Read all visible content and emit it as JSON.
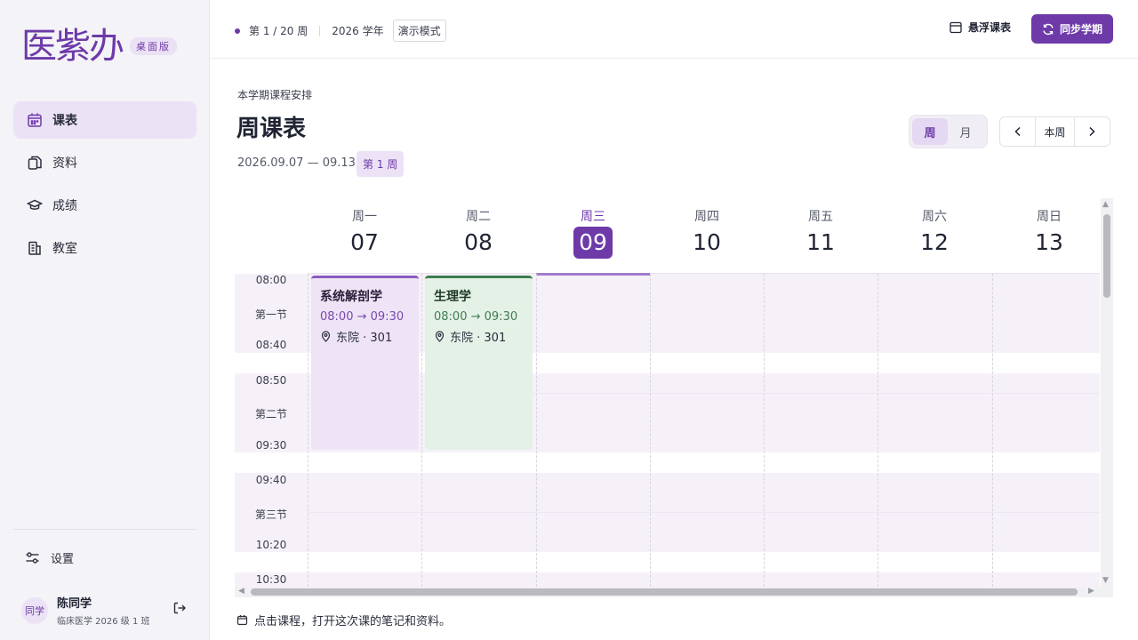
{
  "app": {
    "logo_text": "医紫办",
    "edition_badge": "桌面版"
  },
  "sidebar": {
    "items": [
      {
        "label": "课表",
        "icon": "calendar-icon",
        "active": true
      },
      {
        "label": "资料",
        "icon": "files-icon",
        "active": false
      },
      {
        "label": "成绩",
        "icon": "graduation-cap-icon",
        "active": false
      },
      {
        "label": "教室",
        "icon": "building-icon",
        "active": false
      }
    ],
    "settings_label": "设置",
    "user": {
      "avatar_text": "同学",
      "name": "陈同学",
      "class": "临床医学 2026 级 1 班"
    }
  },
  "topbar": {
    "week_status": "第 1 / 20 周",
    "year": "2026 学年",
    "mode_chip": "演示模式",
    "float_label": "悬浮课表",
    "sync_label": "同步学期"
  },
  "header": {
    "eyebrow": "本学期课程安排",
    "title": "周课表",
    "date_range": "2026.09.07 — 09.13",
    "week_badge": "第 1 周",
    "view_week": "周",
    "view_month": "月",
    "pager_current": "本周"
  },
  "calendar": {
    "days": [
      {
        "name": "周一",
        "date": "07"
      },
      {
        "name": "周二",
        "date": "08"
      },
      {
        "name": "周三",
        "date": "09",
        "today": true
      },
      {
        "name": "周四",
        "date": "10"
      },
      {
        "name": "周五",
        "date": "11"
      },
      {
        "name": "周六",
        "date": "12"
      },
      {
        "name": "周日",
        "date": "13"
      }
    ],
    "periods": [
      {
        "label": "第一节",
        "start": "08:00",
        "end": "08:40"
      },
      {
        "label": "第二节",
        "start": "08:50",
        "end": "09:30"
      },
      {
        "label": "第三节",
        "start": "09:40",
        "end": "10:20"
      },
      {
        "label": "",
        "start": "10:30",
        "end": ""
      }
    ],
    "courses": [
      {
        "name": "系统解剖学",
        "start": "08:00",
        "end": "09:30",
        "location": "东院 · 301",
        "day": "周一",
        "color": "#8a5bbf"
      },
      {
        "name": "生理学",
        "start": "08:00",
        "end": "09:30",
        "location": "东院 · 301",
        "day": "周二",
        "color": "#3f7d52"
      }
    ]
  },
  "footer": {
    "hint": "点击课程，打开这次课的笔记和资料。"
  },
  "colors": {
    "accent": "#6d3aa8",
    "band": "#f6f1f9"
  }
}
